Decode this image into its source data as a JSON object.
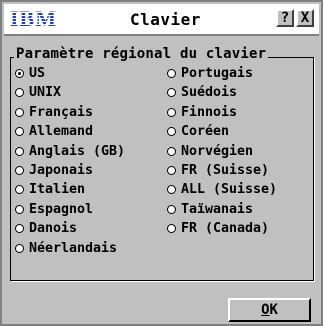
{
  "window": {
    "title": "Clavier",
    "logo_text": "IBM",
    "help_label": "?",
    "close_label": "X"
  },
  "group": {
    "legend": "Paramètre régional du clavier"
  },
  "options": {
    "left": [
      {
        "label": "US",
        "selected": true
      },
      {
        "label": "UNIX",
        "selected": false
      },
      {
        "label": "Français",
        "selected": false
      },
      {
        "label": "Allemand",
        "selected": false
      },
      {
        "label": "Anglais (GB)",
        "selected": false
      },
      {
        "label": "Japonais",
        "selected": false
      },
      {
        "label": "Italien",
        "selected": false
      },
      {
        "label": "Espagnol",
        "selected": false
      },
      {
        "label": "Danois",
        "selected": false
      },
      {
        "label": "Néerlandais",
        "selected": false
      }
    ],
    "right": [
      {
        "label": "Portugais",
        "selected": false
      },
      {
        "label": "Suédois",
        "selected": false
      },
      {
        "label": "Finnois",
        "selected": false
      },
      {
        "label": "Coréen",
        "selected": false
      },
      {
        "label": "Norvégien",
        "selected": false
      },
      {
        "label": "FR (Suisse)",
        "selected": false
      },
      {
        "label": "ALL (Suisse)",
        "selected": false
      },
      {
        "label": "Taïwanais",
        "selected": false
      },
      {
        "label": "FR (Canada)",
        "selected": false
      }
    ]
  },
  "ok_button": {
    "label_underlined": "O",
    "label_rest": "K"
  },
  "colors": {
    "dialog_bg": "#c0c0c0",
    "titlebar_bg": "#ffffff",
    "logo_blue": "#1f3fbf"
  }
}
